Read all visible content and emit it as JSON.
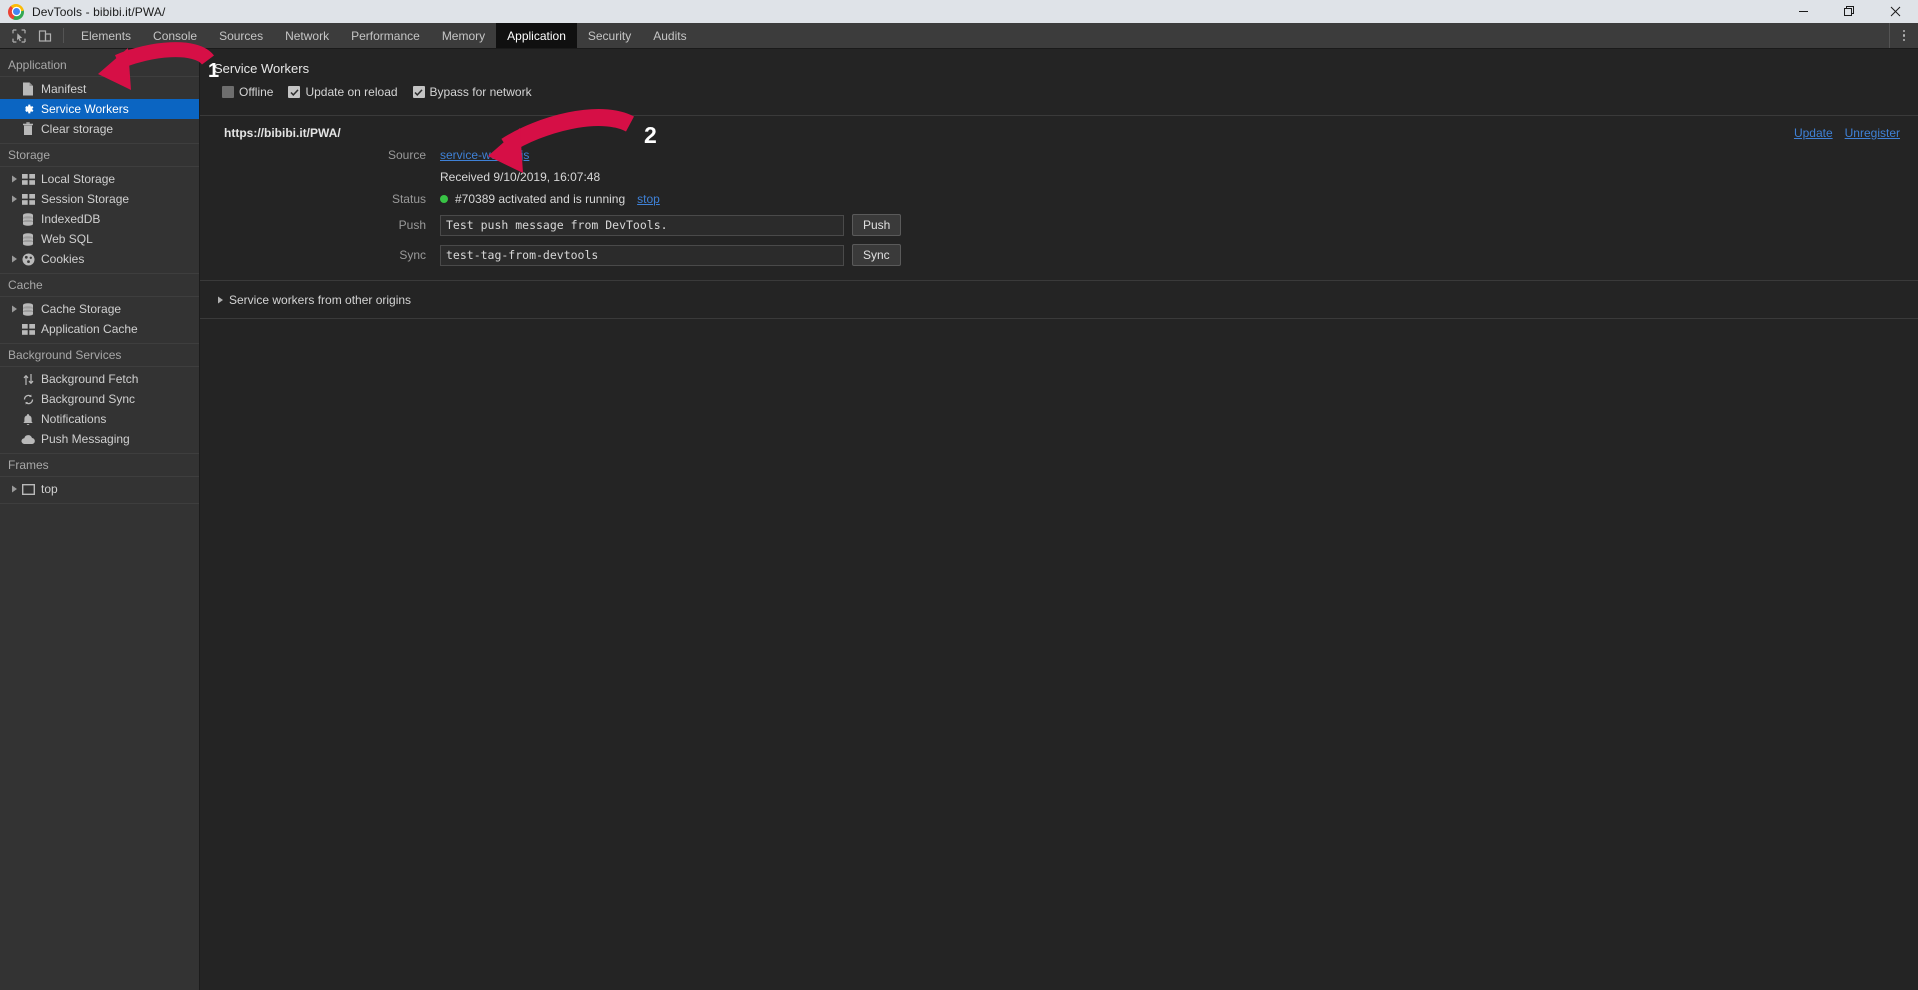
{
  "window": {
    "title": "DevTools - bibibi.it/PWA/",
    "favicon": "chrome-icon",
    "controls": [
      {
        "name": "minimize-button",
        "icon": "minimize-icon"
      },
      {
        "name": "maximize-button",
        "icon": "restore-icon"
      },
      {
        "name": "close-button",
        "icon": "close-icon"
      }
    ]
  },
  "toolbar": {
    "icons": [
      {
        "name": "inspect-element-icon",
        "label": "inspect-element"
      },
      {
        "name": "device-toolbar-icon",
        "label": "toggle-device-toolbar"
      }
    ],
    "tabs": [
      {
        "label": "Elements",
        "active": false
      },
      {
        "label": "Console",
        "active": false
      },
      {
        "label": "Sources",
        "active": false
      },
      {
        "label": "Network",
        "active": false
      },
      {
        "label": "Performance",
        "active": false
      },
      {
        "label": "Memory",
        "active": false
      },
      {
        "label": "Application",
        "active": true
      },
      {
        "label": "Security",
        "active": false
      },
      {
        "label": "Audits",
        "active": false
      }
    ],
    "more_label": "more-options"
  },
  "sidebar": {
    "groups": [
      {
        "title": "Application",
        "items": [
          {
            "label": "Manifest",
            "icon": "document-icon",
            "twisty": false,
            "selected": false
          },
          {
            "label": "Service Workers",
            "icon": "gear-icon",
            "twisty": false,
            "selected": true
          },
          {
            "label": "Clear storage",
            "icon": "trash-icon",
            "twisty": false,
            "selected": false
          }
        ]
      },
      {
        "title": "Storage",
        "items": [
          {
            "label": "Local Storage",
            "icon": "table-icon",
            "twisty": true,
            "selected": false
          },
          {
            "label": "Session Storage",
            "icon": "table-icon",
            "twisty": true,
            "selected": false
          },
          {
            "label": "IndexedDB",
            "icon": "database-icon",
            "twisty": false,
            "selected": false
          },
          {
            "label": "Web SQL",
            "icon": "database-icon",
            "twisty": false,
            "selected": false
          },
          {
            "label": "Cookies",
            "icon": "cookie-icon",
            "twisty": true,
            "selected": false
          }
        ]
      },
      {
        "title": "Cache",
        "items": [
          {
            "label": "Cache Storage",
            "icon": "database-icon",
            "twisty": true,
            "selected": false
          },
          {
            "label": "Application Cache",
            "icon": "table-icon",
            "twisty": false,
            "selected": false
          }
        ]
      },
      {
        "title": "Background Services",
        "items": [
          {
            "label": "Background Fetch",
            "icon": "updown-arrows-icon",
            "twisty": false,
            "selected": false
          },
          {
            "label": "Background Sync",
            "icon": "sync-icon",
            "twisty": false,
            "selected": false
          },
          {
            "label": "Notifications",
            "icon": "bell-icon",
            "twisty": false,
            "selected": false
          },
          {
            "label": "Push Messaging",
            "icon": "cloud-icon",
            "twisty": false,
            "selected": false
          }
        ]
      },
      {
        "title": "Frames",
        "items": [
          {
            "label": "top",
            "icon": "frame-icon",
            "twisty": true,
            "selected": false
          }
        ]
      }
    ]
  },
  "main": {
    "panel_title": "Service Workers",
    "options": [
      {
        "label": "Offline",
        "checked": false
      },
      {
        "label": "Update on reload",
        "checked": true
      },
      {
        "label": "Bypass for network",
        "checked": true
      }
    ],
    "registration": {
      "origin": "https://bibibi.it/PWA/",
      "update_label": "Update",
      "unregister_label": "Unregister",
      "source_label": "Source",
      "source_file": "service-worker.js",
      "received_text": "Received 9/10/2019, 16:07:48",
      "status_label": "Status",
      "status_text": "#70389 activated and is running",
      "status_color": "#38c345",
      "stop_label": "stop",
      "push_label": "Push",
      "push_value": "Test push message from DevTools.",
      "push_button": "Push",
      "sync_label": "Sync",
      "sync_value": "test-tag-from-devtools",
      "sync_button": "Sync"
    },
    "other_origins_label": "Service workers from other origins"
  },
  "annotations": {
    "color": "#d60f46",
    "number_color": "#ffffff",
    "items": [
      {
        "number": "1",
        "target": "sidebar-item-service-workers"
      },
      {
        "number": "2",
        "target": "registration-origin"
      }
    ]
  }
}
